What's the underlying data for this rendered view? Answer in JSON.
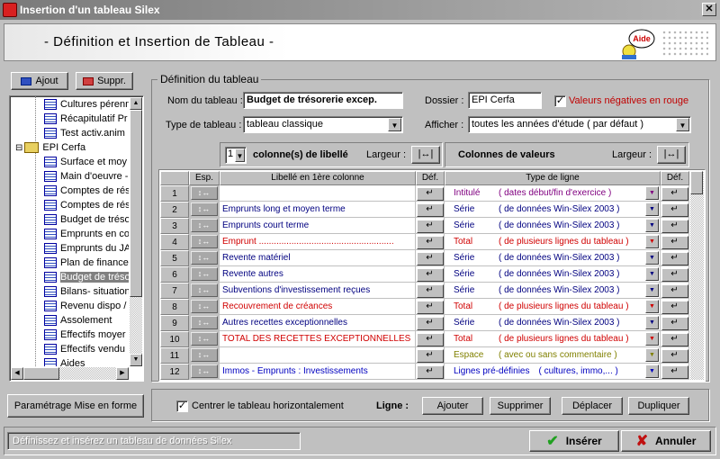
{
  "window": {
    "title": "Insertion d'un tableau Silex"
  },
  "banner": {
    "title": "- Définition et Insertion de Tableau -",
    "help_label": "Aide"
  },
  "sidebar": {
    "add_label": "Ajout",
    "delete_label": "Suppr.",
    "tree": [
      {
        "label": "Cultures pérenn",
        "level": 2
      },
      {
        "label": "Récapitulatif Pr",
        "level": 2
      },
      {
        "label": "Test activ.anim",
        "level": 2
      },
      {
        "label": "EPI Cerfa",
        "level": 1
      },
      {
        "label": "Surface et moy",
        "level": 2
      },
      {
        "label": "Main d'oeuvre -",
        "level": 2
      },
      {
        "label": "Comptes de rés",
        "level": 2
      },
      {
        "label": "Comptes de rés",
        "level": 2
      },
      {
        "label": "Budget de trésor",
        "level": 2
      },
      {
        "label": "Emprunts en co",
        "level": 2
      },
      {
        "label": "Emprunts du JA",
        "level": 2
      },
      {
        "label": "Plan de finance",
        "level": 2
      },
      {
        "label": "Budget de trésor",
        "level": 2,
        "selected": true
      },
      {
        "label": "Bilans- situation",
        "level": 2
      },
      {
        "label": "Revenu dispo /",
        "level": 2
      },
      {
        "label": "Assolement",
        "level": 2
      },
      {
        "label": "Effectifs moyer",
        "level": 2
      },
      {
        "label": "Effectifs vendu",
        "level": 2
      },
      {
        "label": "Aides",
        "level": 2
      }
    ],
    "format_button": "Paramétrage Mise en forme"
  },
  "definition": {
    "group_title": "Définition du tableau",
    "name_label": "Nom du tableau :",
    "name_value": "Budget de trésorerie excep.",
    "folder_label": "Dossier :",
    "folder_value": "EPI Cerfa",
    "negative_label": "Valeurs négatives en rouge",
    "negative_checked": true,
    "type_label": "Type de tableau :",
    "type_value": "tableau classique",
    "display_label": "Afficher :",
    "display_value": "toutes les années d'étude ( par défaut )",
    "label_cols_count": "1",
    "label_cols_text": "colonne(s) de libellé",
    "width_label": "Largeur :",
    "value_cols_text": "Colonnes de valeurs",
    "width_label2": "Largeur :"
  },
  "table": {
    "headers": [
      "Esp.",
      "Libellé en 1ère colonne",
      "Déf.",
      "Type de ligne",
      "Déf."
    ],
    "rows": [
      {
        "n": "1",
        "label": "",
        "label_color": "#000080",
        "type": "Intitulé",
        "desc": "( dates début/fin d'exercice )",
        "type_color": "#800080"
      },
      {
        "n": "2",
        "label": "Emprunts long et moyen terme",
        "label_color": "#000080",
        "type": "Série",
        "desc": "( de données Win-Silex 2003 )",
        "type_color": "#000080"
      },
      {
        "n": "3",
        "label": "Emprunts court terme",
        "label_color": "#000080",
        "type": "Série",
        "desc": "( de données Win-Silex 2003 )",
        "type_color": "#000080"
      },
      {
        "n": "4",
        "label": "Emprunt ......................................................",
        "label_color": "#d00000",
        "type": "Total",
        "desc": "( de plusieurs lignes du tableau )",
        "type_color": "#d00000"
      },
      {
        "n": "5",
        "label": "Revente matériel",
        "label_color": "#000080",
        "type": "Série",
        "desc": "( de données Win-Silex 2003 )",
        "type_color": "#000080"
      },
      {
        "n": "6",
        "label": "Revente autres",
        "label_color": "#000080",
        "type": "Série",
        "desc": "( de données Win-Silex 2003 )",
        "type_color": "#000080"
      },
      {
        "n": "7",
        "label": "Subventions d'investissement reçues",
        "label_color": "#000080",
        "type": "Série",
        "desc": "( de données Win-Silex 2003 )",
        "type_color": "#000080"
      },
      {
        "n": "8",
        "label": "Recouvrement de créances",
        "label_color": "#d00000",
        "type": "Total",
        "desc": "( de plusieurs lignes du tableau )",
        "type_color": "#d00000"
      },
      {
        "n": "9",
        "label": "Autres recettes exceptionnelles",
        "label_color": "#000080",
        "type": "Série",
        "desc": "( de données Win-Silex 2003 )",
        "type_color": "#000080"
      },
      {
        "n": "10",
        "label": "TOTAL DES RECETTES EXCEPTIONNELLES",
        "label_color": "#d00000",
        "type": "Total",
        "desc": "( de plusieurs lignes du tableau )",
        "type_color": "#d00000"
      },
      {
        "n": "11",
        "label": "",
        "label_color": "#000080",
        "type": "Espace",
        "desc": "( avec ou sans commentaire )",
        "type_color": "#808000"
      },
      {
        "n": "12",
        "label": "Immos - Emprunts : Investissements",
        "label_color": "#0000c0",
        "type": "Lignes pré-définies",
        "desc": "( cultures, immo,... )",
        "type_color": "#0000c0"
      }
    ]
  },
  "bottom": {
    "center_label": "Centrer le tableau horizontalement",
    "center_checked": true,
    "line_label": "Ligne :",
    "add": "Ajouter",
    "delete": "Supprimer",
    "move": "Déplacer",
    "duplicate": "Dupliquer"
  },
  "status": {
    "text": "Définissez et insérez un tableau de données Silex"
  },
  "actions": {
    "insert": "Insérer",
    "cancel": "Annuler"
  },
  "icons": {
    "insert": "check-icon",
    "cancel": "x-icon",
    "close": "close-icon",
    "help": "help-mascot-icon"
  }
}
